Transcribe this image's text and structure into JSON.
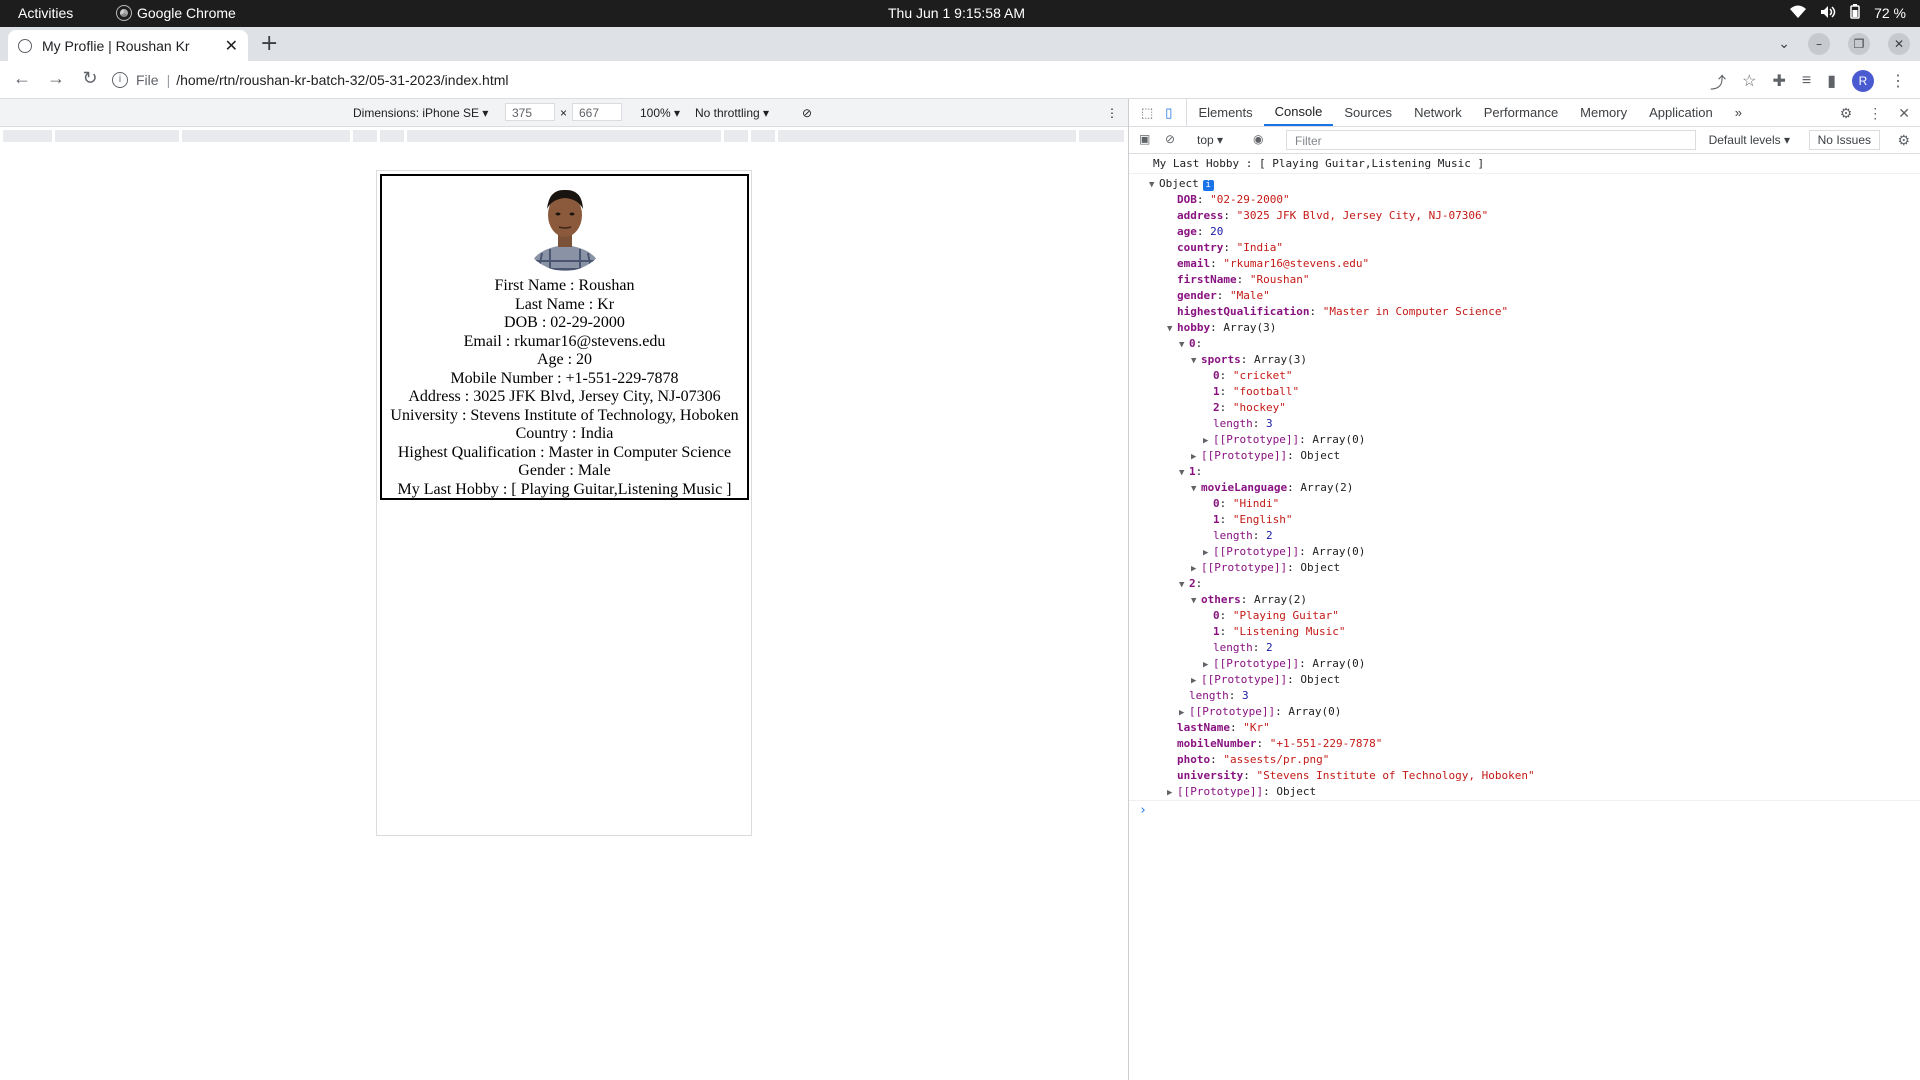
{
  "system": {
    "activities": "Activities",
    "app_name": "Google Chrome",
    "clock": "Thu Jun 1  9:15:58 AM",
    "battery": "72 %"
  },
  "browser": {
    "tab_title": "My Proflie | Roushan Kr",
    "url_scheme": "File",
    "url": "/home/rtn/roushan-kr-batch-32/05-31-2023/index.html"
  },
  "device_toolbar": {
    "dimensions_label": "Dimensions: iPhone SE",
    "width": "375",
    "times": "×",
    "height": "667",
    "zoom": "100%",
    "throttling": "No throttling"
  },
  "profile": {
    "lines": [
      "First Name : Roushan",
      "Last Name : Kr",
      "DOB : 02-29-2000",
      "Email : rkumar16@stevens.edu",
      "Age : 20",
      "Mobile Number : +1-551-229-7878",
      "Address : 3025 JFK Blvd, Jersey City, NJ-07306",
      "University : Stevens Institute of Technology, Hoboken",
      "Country : India",
      "Highest Qualification : Master in Computer Science",
      "Gender : Male",
      "My Last Hobby : [ Playing Guitar,Listening Music ]"
    ]
  },
  "devtools": {
    "tabs": [
      "Elements",
      "Console",
      "Sources",
      "Network",
      "Performance",
      "Memory",
      "Application"
    ],
    "active_tab": "Console",
    "context": "top",
    "filter_placeholder": "Filter",
    "levels": "Default levels",
    "issues": "No Issues",
    "log_message": "My Last Hobby : [ Playing Guitar,Listening Music ]",
    "object_label": "Object"
  },
  "colors": {
    "accent": "#1a73e8",
    "key": "#881280",
    "string": "#c41a16",
    "number": "#1a1aa6"
  }
}
